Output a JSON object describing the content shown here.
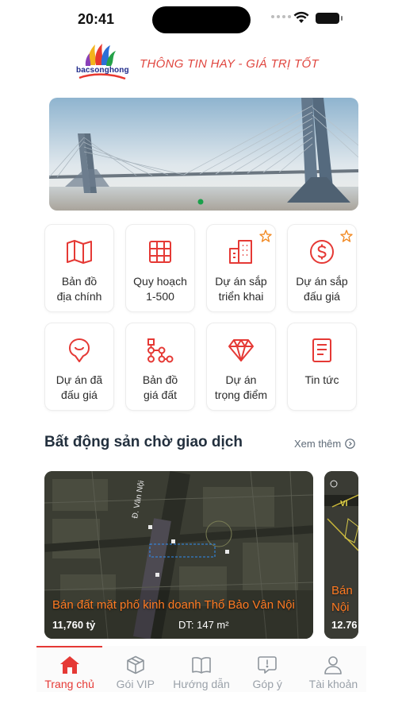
{
  "status": {
    "time": "20:41"
  },
  "header": {
    "logo_text": "bacsonghong",
    "slogan": "THÔNG TIN HAY - GIÁ TRỊ TỐT"
  },
  "banner": {
    "dots": 1,
    "active_dot": 0
  },
  "features": [
    {
      "label": "Bản đồ\nđịa chính",
      "icon": "map-icon",
      "starred": false
    },
    {
      "label": "Quy hoạch\n1-500",
      "icon": "grid-plan-icon",
      "starred": false
    },
    {
      "label": "Dự án sắp\ntriển khai",
      "icon": "buildings-icon",
      "starred": true
    },
    {
      "label": "Dự án sắp\nđấu giá",
      "icon": "dollar-icon",
      "starred": true
    },
    {
      "label": "Dự án đã\nđấu giá",
      "icon": "location-pin-icon",
      "starred": false
    },
    {
      "label": "Bản đồ\ngiá đất",
      "icon": "flow-chart-icon",
      "starred": false
    },
    {
      "label": "Dự án\ntrọng điểm",
      "icon": "diamond-icon",
      "starred": false
    },
    {
      "label": "Tin tức",
      "icon": "news-icon",
      "starred": false
    }
  ],
  "section": {
    "title": "Bất động sản chờ giao dịch",
    "see_more": "Xem thêm"
  },
  "listings": [
    {
      "title": "Bán đất mặt phố kinh doanh Thổ Bảo Vân Nội",
      "price": "11,760 tỷ",
      "area": "DT: 147 m²",
      "map_label": "Đ. Vân Nội"
    },
    {
      "title": "Bán\nNội",
      "price": "12.76",
      "map_label": "VI"
    }
  ],
  "nav": [
    {
      "label": "Trang chủ",
      "icon": "home-icon",
      "active": true
    },
    {
      "label": "Gói VIP",
      "icon": "package-icon",
      "active": false
    },
    {
      "label": "Hướng dẫn",
      "icon": "book-icon",
      "active": false
    },
    {
      "label": "Góp ý",
      "icon": "feedback-icon",
      "active": false
    },
    {
      "label": "Tài khoản",
      "icon": "user-icon",
      "active": false
    }
  ],
  "colors": {
    "accent": "#e53935",
    "star": "#f28c28",
    "listing_title": "#ff7a22"
  }
}
